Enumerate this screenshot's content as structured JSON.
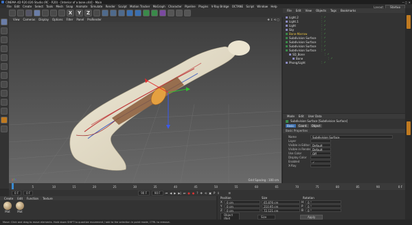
{
  "window": {
    "title": "CINEMA 4D R20.026 Studio (RC - R20) - [Interior of a bone.c4d] - Main"
  },
  "menu": [
    "File",
    "Edit",
    "Create",
    "Select",
    "Tools",
    "Mesh",
    "Snap",
    "Animate",
    "Simulate",
    "Render",
    "Sculpt",
    "Motion Tracker",
    "MoGraph",
    "Character",
    "Pipeline",
    "Plugins",
    "V-Ray Bridge",
    "OCTANE",
    "Script",
    "Window",
    "Help"
  ],
  "layout": {
    "label": "Layout:",
    "value": "Startup"
  },
  "toolbar": {
    "axis_x": "X",
    "axis_y": "Y",
    "axis_z": "Z"
  },
  "viewport": {
    "menu": [
      "View",
      "Cameras",
      "Display",
      "Options",
      "Filter",
      "Panel",
      "ProRender"
    ],
    "label": "Perspective",
    "grid": "Grid Spacing : 100 cm"
  },
  "objects": {
    "tabs": [
      "File",
      "Edit",
      "View",
      "Objects",
      "Tags",
      "Bookmarks"
    ],
    "items": [
      {
        "name": "Light.2",
        "indent": 0
      },
      {
        "name": "Light.1",
        "indent": 0
      },
      {
        "name": "Light",
        "indent": 0
      },
      {
        "name": "Sky",
        "indent": 0
      },
      {
        "name": "Bone-Marrow",
        "indent": 0
      },
      {
        "name": "Subdivision Surface",
        "indent": 0
      },
      {
        "name": "Subdivision Surface",
        "indent": 0
      },
      {
        "name": "Subdivision Surface",
        "indent": 0
      },
      {
        "name": "Subdivision Surface",
        "indent": 0
      },
      {
        "name": "SD_Bone",
        "indent": 1
      },
      {
        "name": "Bone",
        "indent": 2
      },
      {
        "name": "Phong/Light",
        "indent": 0
      }
    ]
  },
  "attributes": {
    "tabs": [
      "Mode",
      "Edit",
      "User Data"
    ],
    "title": "Subdivision Surface [Subdivision Surface]",
    "subtabs": [
      "Basic",
      "Coord.",
      "Object"
    ],
    "section": "Basic Properties",
    "fields": [
      {
        "label": "Name",
        "value": "Subdivision Surface"
      },
      {
        "label": "Layer",
        "value": ""
      },
      {
        "label": "Visible in Editor",
        "value": "Default"
      },
      {
        "label": "Visible in Renderer",
        "value": "Default"
      },
      {
        "label": "Use Color",
        "value": "Off"
      },
      {
        "label": "Display Color",
        "value": ""
      },
      {
        "label": "Enabled",
        "value": "✓"
      },
      {
        "label": "X-Ray",
        "value": ""
      }
    ]
  },
  "timeline": {
    "ticks": [
      "0",
      "5",
      "10",
      "15",
      "20",
      "25",
      "30",
      "35",
      "40",
      "45",
      "50",
      "55",
      "60",
      "65",
      "70",
      "75",
      "80",
      "85",
      "90"
    ],
    "frame_end": "0 F",
    "start": "0 F",
    "current": "0 F",
    "end": "90 F",
    "end2": "90 F"
  },
  "materials": {
    "menu": [
      "Create",
      "Edit",
      "Function",
      "Texture"
    ],
    "items": [
      "Mat",
      "Mat"
    ]
  },
  "coords": {
    "headers": [
      "Position",
      "Size",
      "Rotation"
    ],
    "rows": [
      {
        "axis": "X",
        "pos": "0 cm",
        "size": "65.876 cm",
        "raxis": "H",
        "rot": "0 °"
      },
      {
        "axis": "Y",
        "pos": "0 cm",
        "size": "210.95 cm",
        "raxis": "P",
        "rot": "0 °"
      },
      {
        "axis": "Z",
        "pos": "0 cm",
        "size": "72.121 cm",
        "raxis": "B",
        "rot": "0 °"
      }
    ],
    "mode": "Object (Rel)",
    "size_mode": "Size",
    "apply": "Apply"
  },
  "status": "Move: Click and drag to move elements. Hold down SHIFT to quantize movement / add to the selection in point mode, CTRL to remove.",
  "colors": {
    "accent": "#e8a030",
    "objects_bg": "#333333",
    "viewport_bg": "#5a5a5a"
  }
}
